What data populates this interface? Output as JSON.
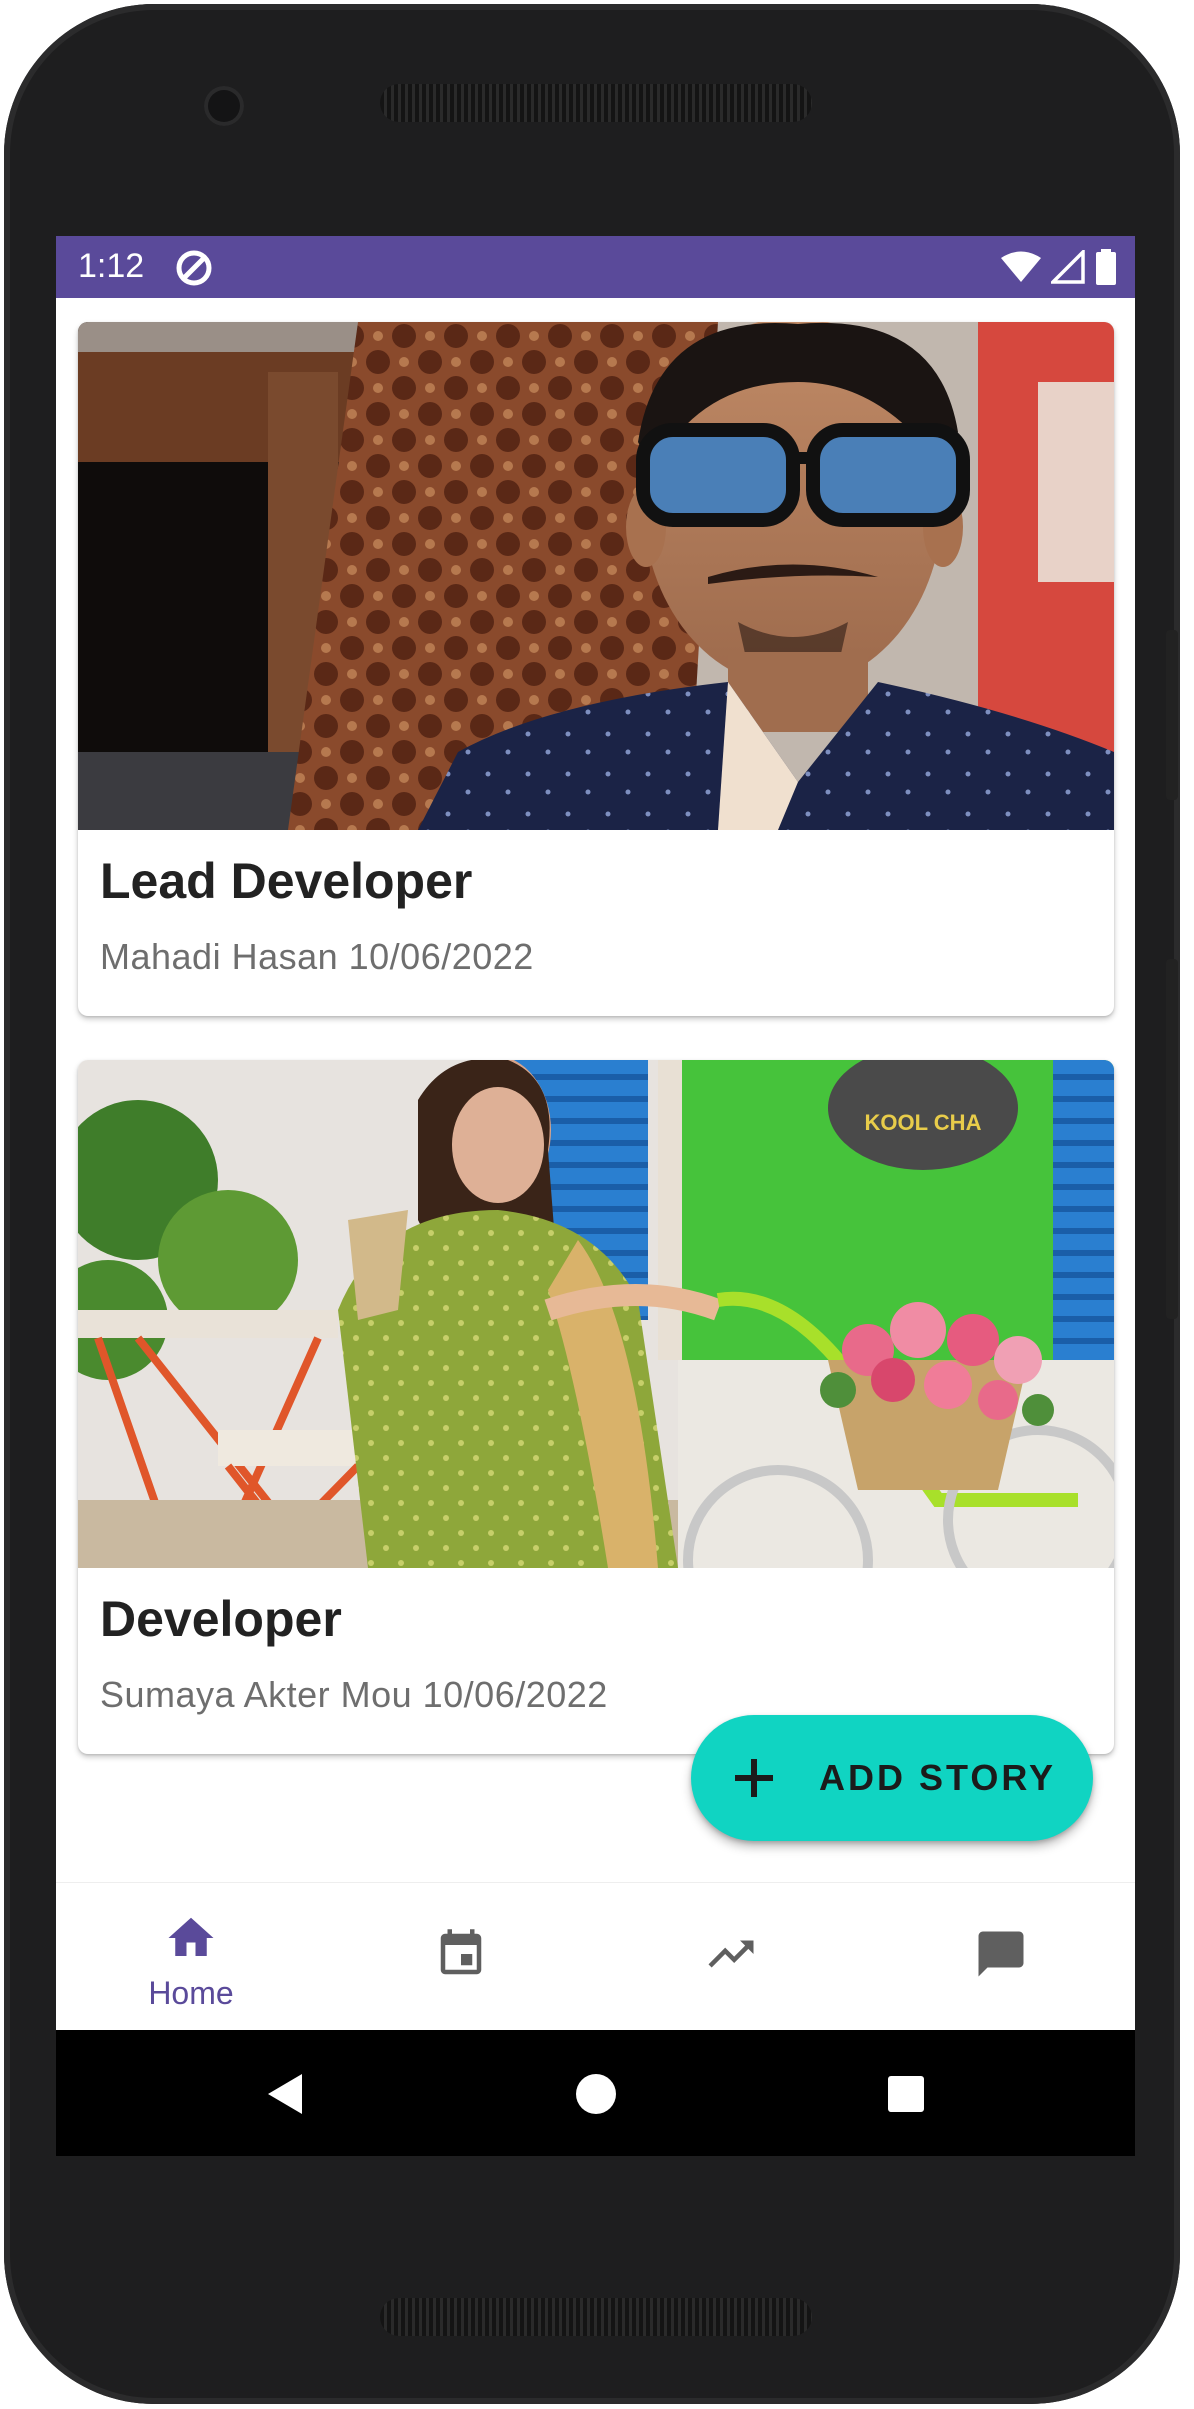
{
  "status_bar": {
    "time": "1:12",
    "color": "#5a4a9a"
  },
  "stories": [
    {
      "title": "Lead Developer",
      "author": "Mahadi Hasan",
      "date": "10/06/2022",
      "meta": "Mahadi Hasan 10/06/2022"
    },
    {
      "title": "Developer",
      "author": "Sumaya Akter Mou",
      "date": "10/06/2022",
      "meta": "Sumaya Akter Mou 10/06/2022",
      "photo_sign": "KOOL CHA"
    }
  ],
  "fab": {
    "icon": "plus-icon",
    "label": "ADD STORY",
    "color": "#10d4c2"
  },
  "bottom_nav": {
    "items": [
      {
        "icon": "home-icon",
        "label": "Home",
        "active": true
      },
      {
        "icon": "calendar-icon",
        "label": ""
      },
      {
        "icon": "trending-up-icon",
        "label": ""
      },
      {
        "icon": "chat-icon",
        "label": ""
      }
    ],
    "active_color": "#5a4a9a",
    "inactive_color": "#5f5f5f"
  },
  "system_nav": {
    "items": [
      "back-icon",
      "home-circle-icon",
      "recents-icon"
    ]
  }
}
